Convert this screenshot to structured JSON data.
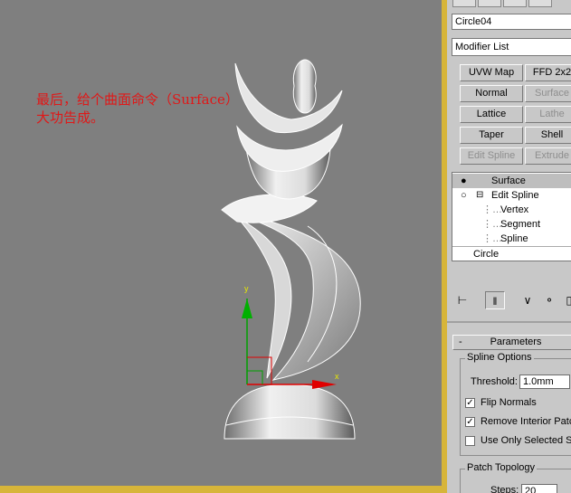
{
  "annotation": {
    "line1": "最后，给个曲面命令（Surface）",
    "line2": "大功告成。"
  },
  "viewport": {
    "axis_y": "y",
    "axis_x": "x"
  },
  "panel": {
    "object_name": "Circle04",
    "modifier_list": "Modifier List",
    "buttons": [
      {
        "label": "UVW Map",
        "enabled": true
      },
      {
        "label": "FFD 2x2",
        "enabled": true
      },
      {
        "label": "Normal",
        "enabled": true
      },
      {
        "label": "Surface",
        "enabled": false
      },
      {
        "label": "Lattice",
        "enabled": true
      },
      {
        "label": "Lathe",
        "enabled": false
      },
      {
        "label": "Taper",
        "enabled": true
      },
      {
        "label": "Shell",
        "enabled": true
      },
      {
        "label": "Edit Spline",
        "enabled": false
      },
      {
        "label": "Extrude",
        "enabled": false
      }
    ],
    "stack": {
      "surface": "Surface",
      "edit_spline": "Edit Spline",
      "vertex": "Vertex",
      "segment": "Segment",
      "spline": "Spline",
      "circle": "Circle"
    },
    "parameters": {
      "rollout_sign": "-",
      "rollout_title": "Parameters",
      "spline_options": "Spline Options",
      "threshold_label": "Threshold:",
      "threshold_value": "1.0mm",
      "flip_normals": "Flip Normals",
      "flip_normals_checked": true,
      "remove_interior": "Remove Interior Patches",
      "remove_interior_checked": true,
      "use_only_selected": "Use Only Selected Segs.",
      "use_only_selected_checked": false,
      "patch_topology": "Patch Topology",
      "steps_label": "Steps:",
      "steps_value": "20"
    }
  }
}
